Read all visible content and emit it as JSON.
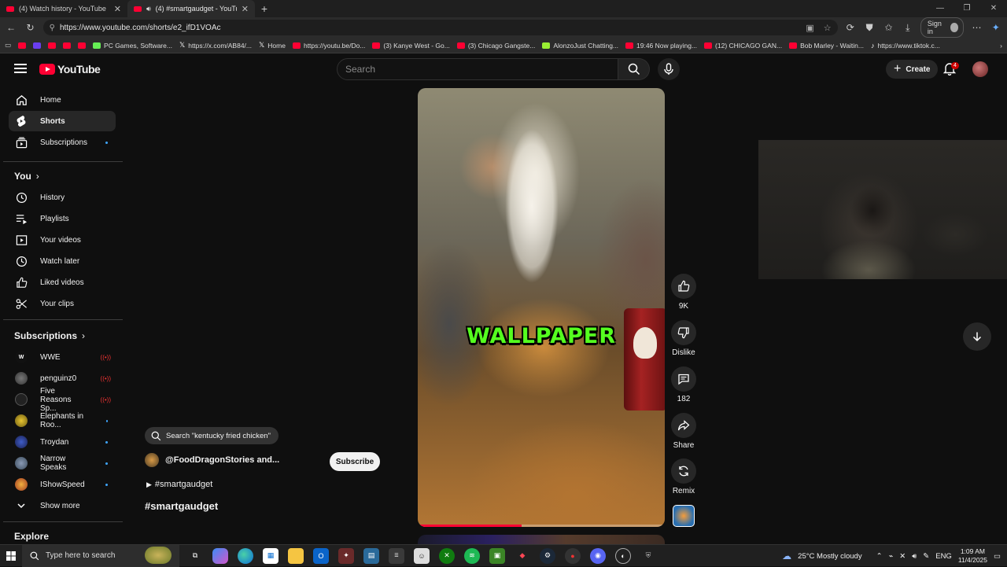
{
  "browser": {
    "tabs": [
      {
        "title": "(4) Watch history - YouTube"
      },
      {
        "title": "(4) #smartgaudget - YouTube"
      }
    ],
    "url": "https://www.youtube.com/shorts/e2_ifD1VOAc",
    "signin_label": "Sign in",
    "bookmarks": [
      "PC Games, Software...",
      "https://x.com/AB84/...",
      "Home",
      "https://youtu.be/Do...",
      "(3) Kanye West - Go...",
      "(3) Chicago Gangste...",
      "AlonzoJust Chatting...",
      "19:46 Now playing...",
      "(12) CHICAGO GAN...",
      "Bob Marley - Waitin...",
      "https://www.tiktok.c..."
    ]
  },
  "masthead": {
    "logo_text": "YouTube",
    "search_placeholder": "Search",
    "create_label": "Create",
    "notification_count": "4"
  },
  "sidebar": {
    "main": [
      {
        "label": "Home"
      },
      {
        "label": "Shorts"
      },
      {
        "label": "Subscriptions"
      }
    ],
    "you_heading": "You",
    "you_items": [
      {
        "label": "History"
      },
      {
        "label": "Playlists"
      },
      {
        "label": "Your videos"
      },
      {
        "label": "Watch later"
      },
      {
        "label": "Liked videos"
      },
      {
        "label": "Your clips"
      }
    ],
    "subs_heading": "Subscriptions",
    "subs": [
      {
        "label": "WWE",
        "status": "live"
      },
      {
        "label": "penguinz0",
        "status": "live"
      },
      {
        "label": "Five Reasons Sp...",
        "status": "live"
      },
      {
        "label": "Elephants in Roo...",
        "status": "new"
      },
      {
        "label": "Troydan",
        "status": "new"
      },
      {
        "label": "Narrow Speaks",
        "status": "new"
      },
      {
        "label": "IShowSpeed",
        "status": "new"
      }
    ],
    "show_more": "Show more",
    "explore_heading": "Explore"
  },
  "short": {
    "caption_overlay": "WALLPAPER",
    "search_suggestion": "Search \"kentucky fried chicken\"",
    "channel": "@FoodDragonStories and...",
    "subscribe_label": "Subscribe",
    "hashtag_line": "#smartgaudget",
    "title": "#smartgaudget",
    "progress_fraction": 0.42,
    "actions": {
      "likes": "9K",
      "dislike": "Dislike",
      "comments": "182",
      "share": "Share",
      "remix": "Remix"
    }
  },
  "taskbar": {
    "search_placeholder": "Type here to search",
    "weather": "25°C  Mostly cloudy",
    "language": "ENG",
    "time": "1:09 AM",
    "date": "11/4/2025"
  },
  "colors": {
    "accent_red": "#ff0033",
    "caption_green": "#55ff1f"
  }
}
